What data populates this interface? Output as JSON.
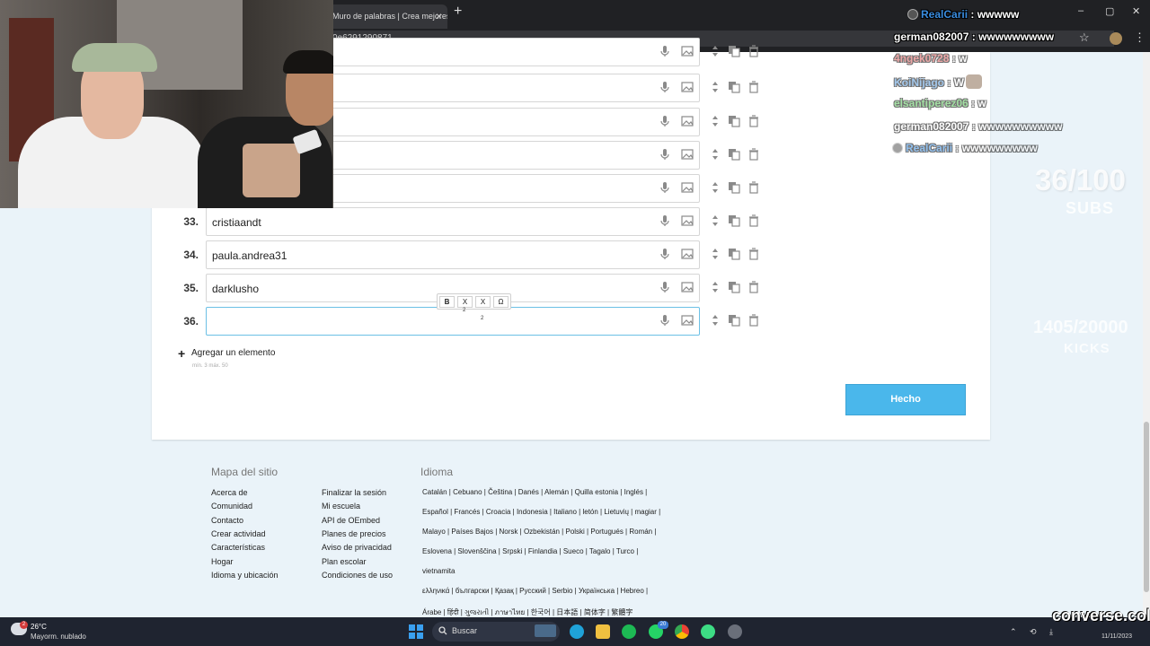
{
  "browser": {
    "tab_title": "Muro de palabras | Crea mejores",
    "tab_close": "×",
    "new_tab": "+",
    "url_fragment": "0e6291290871",
    "window_controls": [
      "–",
      "▢",
      "✕"
    ]
  },
  "editor": {
    "rows": [
      {
        "number": "",
        "value": ""
      },
      {
        "number": "",
        "value": ""
      },
      {
        "number": "",
        "value": ""
      },
      {
        "number": "",
        "value": ""
      },
      {
        "number": "",
        "value": ""
      },
      {
        "number": "33.",
        "value": "cristiaandt"
      },
      {
        "number": "34.",
        "value": "paula.andrea31"
      },
      {
        "number": "35.",
        "value": "darklusho"
      },
      {
        "number": "36.",
        "value": ""
      }
    ],
    "format_toolbar": {
      "bold": "B",
      "subscript": "X",
      "superscript": "X",
      "special_chars": "Ω",
      "sub_mark": "2",
      "sup_mark": "2"
    },
    "add_icon": "+",
    "add_label": "Agregar un elemento",
    "add_hint": "mín. 3 máx. 50",
    "done_label": "Hecho"
  },
  "footer": {
    "sitemap_title": "Mapa del sitio",
    "col1": [
      "Acerca de",
      "Comunidad",
      "Contacto",
      "Crear actividad",
      "Características",
      "Hogar",
      "Idioma y ubicación"
    ],
    "col2": [
      "Finalizar la sesión",
      "Mi escuela",
      "API de OEmbed",
      "Planes de precios",
      "Aviso de privacidad",
      "Plan escolar",
      "Condiciones de uso"
    ],
    "language_title": "Idioma",
    "language_lines": [
      "Catalán  |  Cebuano  |  Čeština  |  Danés  |  Alemán  |  Quilla estonia  |  Inglés  |",
      "Español  |  Francés  |  Croacia  |  Indonesia  |  Italiano  |  letón  |  Lietuvių  |  magiar  |",
      "Malayo  |  Países Bajos  |  Norsk  |  Ozbekistán  |  Polski  |  Portugués  |  Román  |",
      "Eslovena  |  Slovenščina  |  Srpski  |  Finlandia  |  Sueco  |  Tagalo  |  Turco  |",
      "vietnamita",
      "ελληνικά  |  български  |  Қазақ  |  Русский  |  Serbio  |  Українська  |  Hebreo  |",
      "Árabe  |  हिंदी  |  ગુજરાતી  |  ภาษาไทย  |  한국어  |  日本語  |  简体字  |  繁體字"
    ]
  },
  "stream_overlay": {
    "chat": [
      {
        "user": "RealCarii",
        "message": "wwwww",
        "color": "#3a8de0"
      },
      {
        "user": "german082007",
        "message": "wwwwwwwww",
        "color": "#ffffff"
      },
      {
        "user": "4ngek0728",
        "message": "w",
        "color": "#e06060"
      },
      {
        "user": "KoiNijago",
        "message": "W",
        "color": "#5a9de0"
      },
      {
        "user": "elsantiperez06",
        "message": "w",
        "color": "#5ac85a"
      },
      {
        "user": "german082007",
        "message": "wwwwwwwwww",
        "color": "#ffffff"
      },
      {
        "user": "RealCarii",
        "message": "wwwwwwwww",
        "color": "#3a8de0"
      }
    ],
    "separator": " : ",
    "subs_count": "36/100",
    "subs_label": "SUBS",
    "kicks_count": "1405/20000",
    "kicks_label": "KICKS",
    "brand": "converse.col"
  },
  "taskbar": {
    "weather_temp": "26°C",
    "weather_desc": "Mayorm. nublado",
    "weather_badge": "2",
    "search_label": "Buscar",
    "whatsapp_badge": "20",
    "date": "11/11/2023"
  }
}
